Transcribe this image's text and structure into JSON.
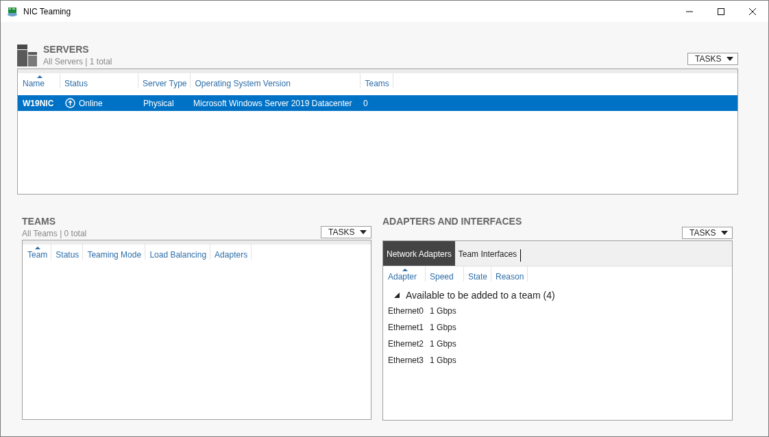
{
  "window": {
    "title": "NIC Teaming"
  },
  "servers": {
    "title": "SERVERS",
    "subtitle": "All Servers | 1 total",
    "tasks": "TASKS",
    "columns": [
      {
        "label": "Name",
        "sorted": true
      },
      {
        "label": "Status",
        "sorted": false
      },
      {
        "label": "Server Type",
        "sorted": false
      },
      {
        "label": "Operating System Version",
        "sorted": false
      },
      {
        "label": "Teams",
        "sorted": false
      }
    ],
    "rows": [
      {
        "name": "W19NIC",
        "status": "Online",
        "server_type": "Physical",
        "os_version": "Microsoft Windows Server 2019 Datacenter",
        "teams": "0",
        "selected": true
      }
    ]
  },
  "teams": {
    "title": "TEAMS",
    "subtitle": "All Teams | 0 total",
    "tasks": "TASKS",
    "columns": [
      {
        "label": "Team",
        "sorted": true
      },
      {
        "label": "Status",
        "sorted": false
      },
      {
        "label": "Teaming Mode",
        "sorted": false
      },
      {
        "label": "Load Balancing",
        "sorted": false
      },
      {
        "label": "Adapters",
        "sorted": false
      }
    ]
  },
  "adapters": {
    "title": "ADAPTERS AND INTERFACES",
    "tasks": "TASKS",
    "tabs": [
      {
        "label": "Network Adapters",
        "selected": true
      },
      {
        "label": "Team Interfaces",
        "selected": false
      }
    ],
    "columns": [
      {
        "label": "Adapter",
        "sorted": true
      },
      {
        "label": "Speed",
        "sorted": false
      },
      {
        "label": "State",
        "sorted": false
      },
      {
        "label": "Reason",
        "sorted": false
      }
    ],
    "groups": [
      {
        "label": "Available to be added to a team (4)",
        "expanded": true,
        "rows": [
          {
            "adapter": "Ethernet0",
            "speed": "1 Gbps"
          },
          {
            "adapter": "Ethernet1",
            "speed": "1 Gbps"
          },
          {
            "adapter": "Ethernet2",
            "speed": "1 Gbps"
          },
          {
            "adapter": "Ethernet3",
            "speed": "1 Gbps"
          }
        ]
      }
    ]
  }
}
